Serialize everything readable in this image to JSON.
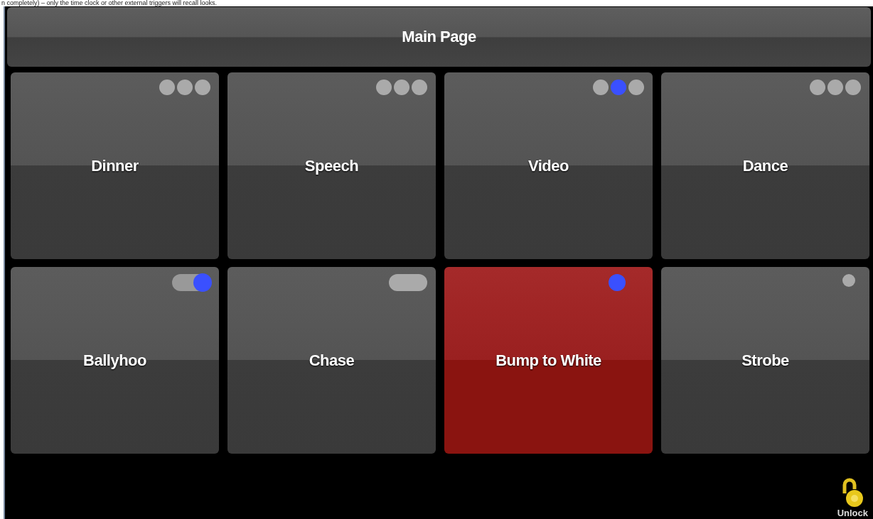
{
  "caption": "n completely) – only the time clock or other external triggers will recall looks.",
  "header": {
    "title": "Main Page"
  },
  "tiles": [
    {
      "label": "Dinner",
      "active": false,
      "indicator": {
        "kind": "steps",
        "steps": [
          {
            "selected": false
          },
          {
            "selected": false
          },
          {
            "selected": false
          }
        ]
      }
    },
    {
      "label": "Speech",
      "active": false,
      "indicator": {
        "kind": "steps",
        "steps": [
          {
            "selected": false
          },
          {
            "selected": false
          },
          {
            "selected": false
          }
        ]
      }
    },
    {
      "label": "Video",
      "active": false,
      "indicator": {
        "kind": "steps",
        "steps": [
          {
            "selected": false
          },
          {
            "selected": true
          },
          {
            "selected": false
          }
        ]
      }
    },
    {
      "label": "Dance",
      "active": false,
      "indicator": {
        "kind": "steps",
        "steps": [
          {
            "selected": false
          },
          {
            "selected": false
          },
          {
            "selected": false
          }
        ]
      }
    },
    {
      "label": "Ballyhoo",
      "active": false,
      "indicator": {
        "kind": "toggle",
        "on": true
      }
    },
    {
      "label": "Chase",
      "active": false,
      "indicator": {
        "kind": "toggle",
        "on": false
      }
    },
    {
      "label": "Bump to White",
      "active": true,
      "indicator": {
        "kind": "led",
        "on": true
      }
    },
    {
      "label": "Strobe",
      "active": false,
      "indicator": {
        "kind": "led",
        "on": false
      }
    }
  ],
  "unlock": {
    "label": "Unlock"
  }
}
